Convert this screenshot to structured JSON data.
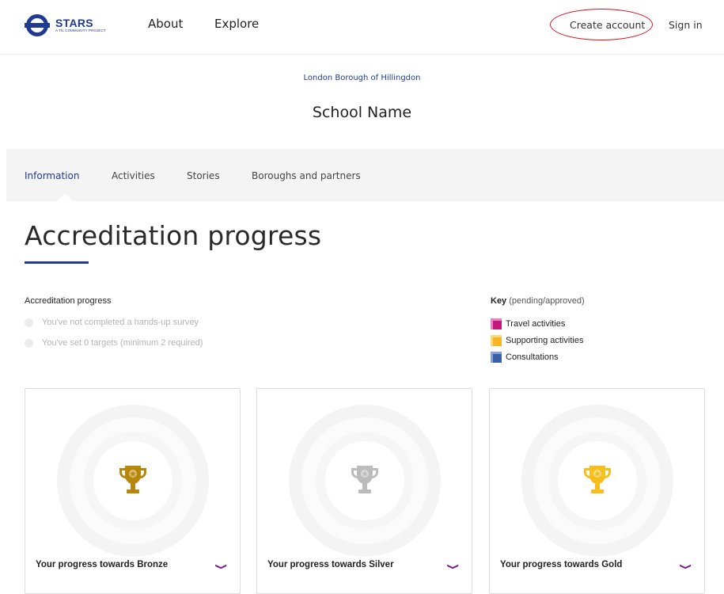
{
  "header": {
    "logo_title": "STARS",
    "logo_subtitle": "A TfL COMMUNITY PROJECT",
    "nav": [
      {
        "label": "About"
      },
      {
        "label": "Explore"
      }
    ],
    "create_account": "Create account",
    "sign_in": "Sign in",
    "annotation_color": "#d6121f"
  },
  "school": {
    "borough": "London Borough of Hillingdon",
    "name": "School Name"
  },
  "tabs": [
    {
      "label": "Information",
      "active": true
    },
    {
      "label": "Activities",
      "active": false
    },
    {
      "label": "Stories",
      "active": false
    },
    {
      "label": "Boroughs and partners",
      "active": false
    }
  ],
  "main": {
    "heading": "Accreditation progress",
    "progress_title": "Accreditation progress",
    "requirements": [
      {
        "text": "You've not completed a hands-up survey"
      },
      {
        "text": "You've set 0 targets (minimum 2 required)"
      }
    ],
    "key": {
      "title": "Key",
      "subtitle": "(pending/approved)",
      "items": [
        {
          "label": "Travel activities",
          "color_pending": "#e982c4",
          "color_approved": "#c2187b"
        },
        {
          "label": "Supporting activities",
          "color_pending": "#fbd77e",
          "color_approved": "#f7b521"
        },
        {
          "label": "Consultations",
          "color_pending": "#8ca0d2",
          "color_approved": "#3c5faa"
        }
      ]
    },
    "cards": [
      {
        "label": "Your progress towards Bronze",
        "trophy_color": "#b8860b",
        "icon": "trophy-icon"
      },
      {
        "label": "Your progress towards Silver",
        "trophy_color": "#bcbcbc",
        "icon": "trophy-icon"
      },
      {
        "label": "Your progress towards Gold",
        "trophy_color": "#f6bf1e",
        "icon": "trophy-icon"
      }
    ]
  },
  "colors": {
    "brand_blue": "#1f3a93",
    "accent_purple": "#7a1f8a"
  }
}
